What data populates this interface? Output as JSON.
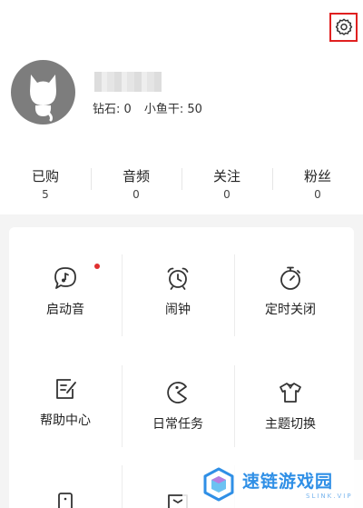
{
  "profile": {
    "diamond_label": "钻石:",
    "diamond_value": "0",
    "fish_label": "小鱼干:",
    "fish_value": "50"
  },
  "counts": [
    {
      "label": "已购",
      "value": "5"
    },
    {
      "label": "音频",
      "value": "0"
    },
    {
      "label": "关注",
      "value": "0"
    },
    {
      "label": "粉丝",
      "value": "0"
    }
  ],
  "features": [
    {
      "label": "启动音",
      "icon": "chat-music-icon"
    },
    {
      "label": "闹钟",
      "icon": "alarm-clock-icon"
    },
    {
      "label": "定时关闭",
      "icon": "stopwatch-icon"
    },
    {
      "label": "帮助中心",
      "icon": "help-note-icon"
    },
    {
      "label": "日常任务",
      "icon": "pacman-icon"
    },
    {
      "label": "主题切换",
      "icon": "tshirt-icon"
    }
  ],
  "watermark": {
    "text": "速链游戏园",
    "sub": "SLINK.VIP"
  },
  "colors": {
    "accent_red": "#e02020",
    "watermark_blue": "#2f8fe6"
  }
}
